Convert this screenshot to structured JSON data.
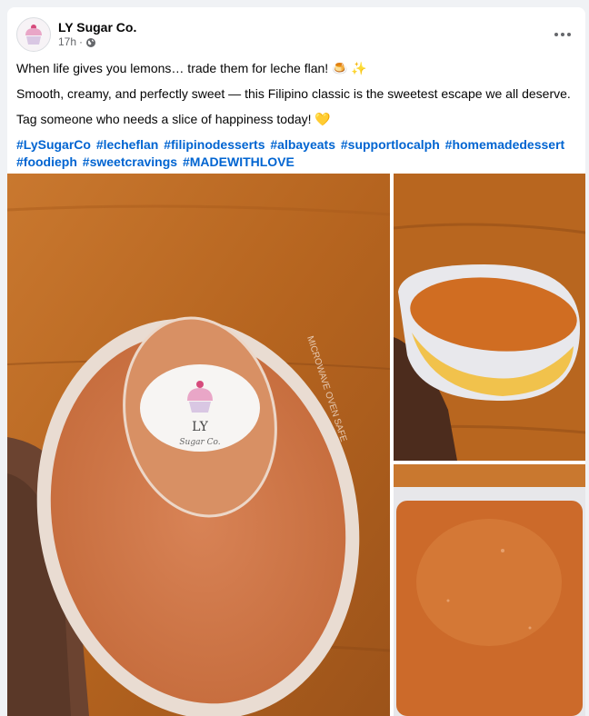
{
  "page": {
    "name": "LY Sugar Co.",
    "time": "17h",
    "audience_icon": "globe-icon"
  },
  "post": {
    "line1": "When life gives you lemons… trade them for leche flan! 🍮 ✨",
    "line2": "Smooth, creamy, and perfectly sweet — this Filipino classic is the sweetest escape we all deserve.",
    "line3": "Tag someone who needs a slice of happiness today! 💛",
    "hashtags": [
      "#LySugarCo",
      "#lecheflan",
      "#filipinodesserts",
      "#albayeats",
      "#supportlocalph",
      "#homemadedessert",
      "#foodieph",
      "#sweetcravings",
      "#MADEWITHLOVE"
    ]
  },
  "photos": {
    "main_label_brand": "LY",
    "main_label_sub": "Sugar Co.",
    "lid_text": "MICROWAVE OVEN SAFE"
  },
  "colors": {
    "link": "#0064d1",
    "wood": "#b86a2a",
    "flan": "#c8692e",
    "muted": "#65676b"
  }
}
